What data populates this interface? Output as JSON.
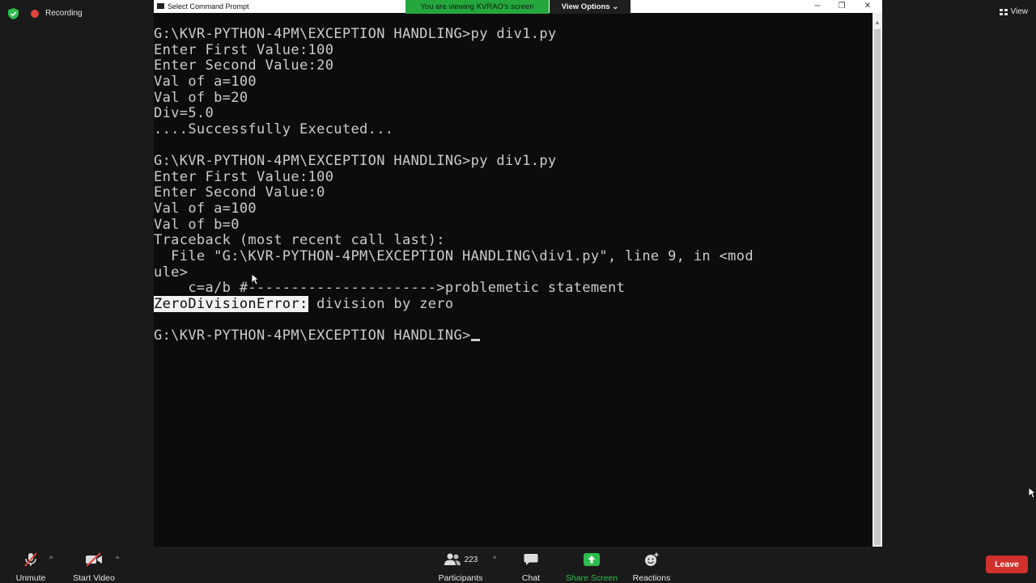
{
  "zoom": {
    "recording_label": "Recording",
    "view_label": "View",
    "share_banner": "You are viewing KVRAO's screen",
    "view_options_label": "View Options",
    "colors": {
      "recording": "#e0443c",
      "share_banner": "#25a73d",
      "leave": "#d0312d",
      "security": "#2dbd4e"
    }
  },
  "cmd": {
    "window_title": "Select Command Prompt",
    "controls": {
      "minimize": "─",
      "maximize": "❐",
      "close": "✕"
    },
    "lines": [
      "G:\\KVR-PYTHON-4PM\\EXCEPTION HANDLING>py div1.py",
      "Enter First Value:100",
      "Enter Second Value:20",
      "Val of a=100",
      "Val of b=20",
      "Div=5.0",
      "....Successfully Executed...",
      "",
      "G:\\KVR-PYTHON-4PM\\EXCEPTION HANDLING>py div1.py",
      "Enter First Value:100",
      "Enter Second Value:0",
      "Val of a=100",
      "Val of b=0",
      "Traceback (most recent call last):",
      "  File \"G:\\KVR-PYTHON-4PM\\EXCEPTION HANDLING\\div1.py\", line 9, in <mod",
      "ule>",
      "    c=a/b #---------------------->problemetic statement"
    ],
    "error_name": "ZeroDivisionError:",
    "error_message": " division by zero",
    "prompt": "G:\\KVR-PYTHON-4PM\\EXCEPTION HANDLING>"
  },
  "toolbar": {
    "unmute": "Unmute",
    "start_video": "Start Video",
    "participants": "Participants",
    "participant_count": "223",
    "chat": "Chat",
    "share_screen": "Share Screen",
    "reactions": "Reactions",
    "leave": "Leave"
  }
}
